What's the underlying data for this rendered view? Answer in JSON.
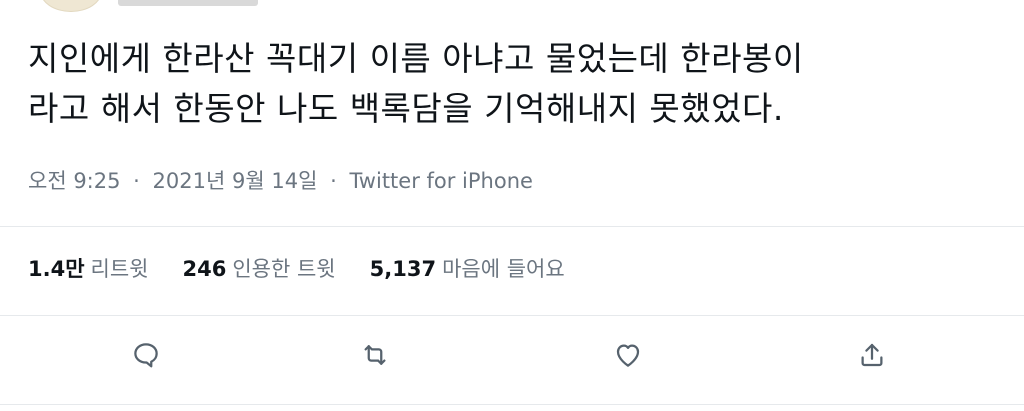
{
  "tweet": {
    "text_line1": "지인에게 한라산 꼭대기 이름 아냐고 물었는데 한라봉이",
    "text_line2": "라고 해서 한동안 나도 백록담을 기억해내지 못했었다."
  },
  "meta": {
    "time": "오전 9:25",
    "separator": "·",
    "date": "2021년 9월 14일",
    "source": "Twitter for iPhone"
  },
  "stats": {
    "retweets": {
      "count": "1.4만",
      "label": "리트윗"
    },
    "quotes": {
      "count": "246",
      "label": "인용한 트윗"
    },
    "likes": {
      "count": "5,137",
      "label": "마음에 들어요"
    }
  },
  "actions": {
    "reply": "reply-icon",
    "retweet": "retweet-icon",
    "like": "heart-icon",
    "share": "share-icon"
  },
  "colors": {
    "text": "#0f1419",
    "secondary": "#6b7580",
    "divider": "#e6e9ec",
    "icon": "#56626d"
  }
}
